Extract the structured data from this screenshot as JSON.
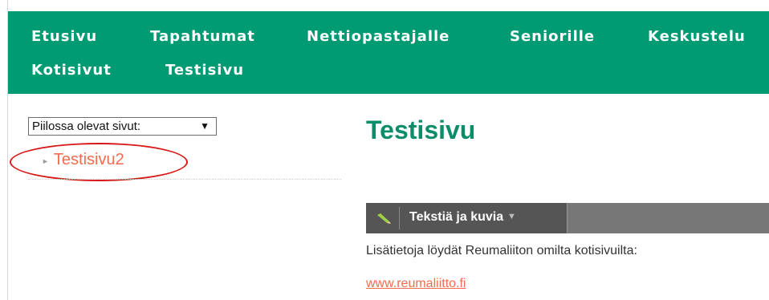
{
  "nav": {
    "items": [
      {
        "label": "Etusivu"
      },
      {
        "label": "Tapahtumat"
      },
      {
        "label": "Nettiopastajalle"
      },
      {
        "label": "Seniorille"
      },
      {
        "label": "Keskustelu"
      },
      {
        "label": "Kotisivut"
      },
      {
        "label": "Testisivu"
      }
    ]
  },
  "sidebar": {
    "hidden_pages_select": {
      "value": "Piilossa olevat sivut:",
      "arrow": "▼"
    },
    "pages": [
      {
        "label": "Testisivu2"
      }
    ]
  },
  "main": {
    "title": "Testisivu",
    "block": {
      "label": "Tekstiä ja kuvia",
      "caret": "▼",
      "icon": "pencil-icon"
    },
    "info_text": "Lisätietoja löydät Reumaliiton omilta kotisivuilta:",
    "link_text": "www.reumaliitto.fi"
  },
  "colors": {
    "nav_bg": "#009a73",
    "title": "#0d8c6a",
    "link": "#f36c4f",
    "highlight_oval": "#d81919",
    "block_bar": "#777777",
    "block_tab": "#555555"
  }
}
